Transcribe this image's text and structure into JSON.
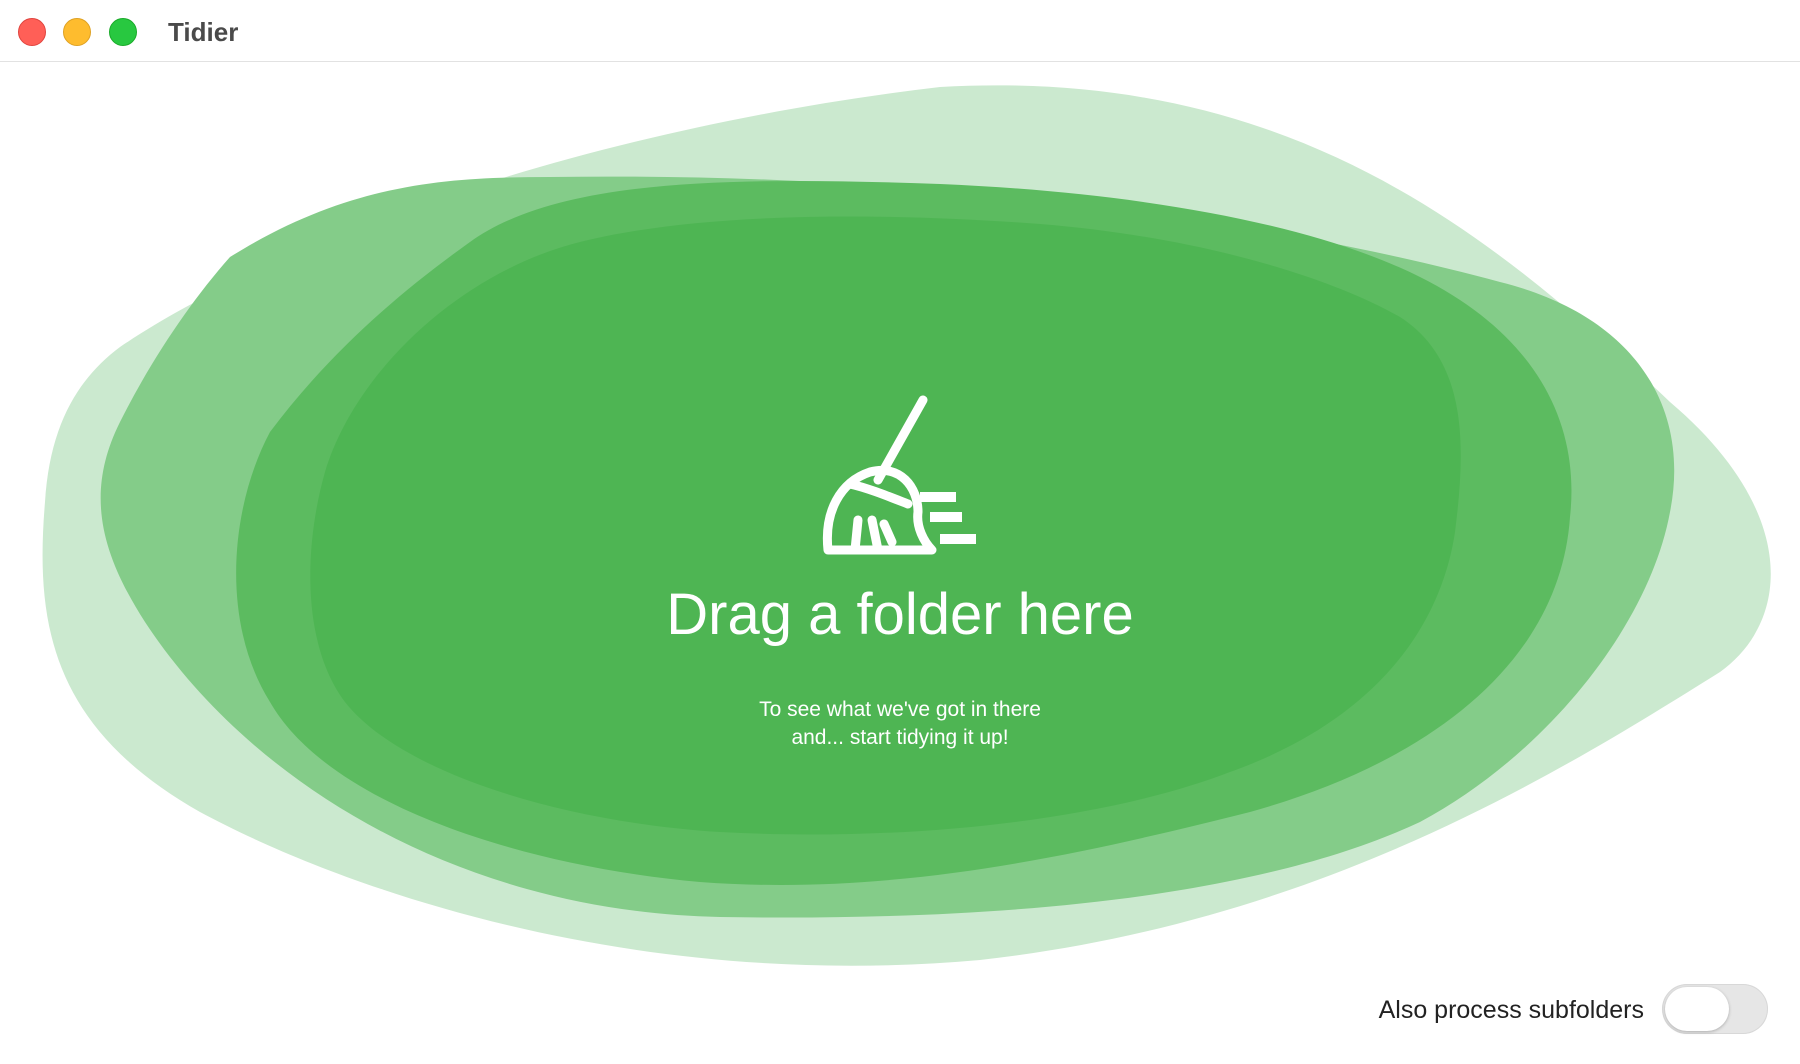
{
  "window": {
    "title": "Tidier"
  },
  "drop_zone": {
    "headline": "Drag a folder here",
    "subtitle_line1": "To see what we've got in there",
    "subtitle_line2": "and... start tidying it up!",
    "icon": "broom-icon"
  },
  "options": {
    "subfolders_label": "Also process subfolders",
    "subfolders_enabled": false
  },
  "colors": {
    "blob_outer": "#cbe9cf",
    "blob_second": "#84cc89",
    "blob_third": "#5cbb60",
    "blob_inner": "#4eb553",
    "text_on_green": "#ffffff"
  }
}
